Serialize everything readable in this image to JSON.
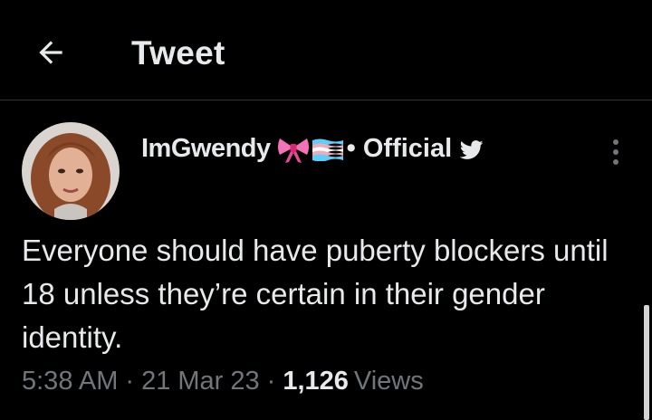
{
  "header": {
    "title": "Tweet",
    "back_icon": "arrow-left-icon"
  },
  "tweet": {
    "author": {
      "display_name": "ImGwendy",
      "name_emojis": [
        "ribbon-bow-icon",
        "transgender-flag-icon"
      ],
      "name_suffix": "• Official",
      "badge_icon": "twitter-bird-icon",
      "avatar": "user-avatar"
    },
    "more_icon": "more-options-icon",
    "text": "Everyone should have puberty blockers until 18 unless they’re certain in their gender identity.",
    "meta": {
      "time": "5:38 AM",
      "separator": "·",
      "date": "21 Mar 23",
      "views_count": "1,126",
      "views_label": "Views"
    }
  },
  "colors": {
    "background": "#000000",
    "primary_text": "#e7e9ea",
    "secondary_text": "#71767b",
    "divider": "#2f3336",
    "bow_pink": "#f472b6",
    "flag_blue": "#5bcefa",
    "flag_pink": "#f5a9b8",
    "flag_white": "#ffffff"
  }
}
